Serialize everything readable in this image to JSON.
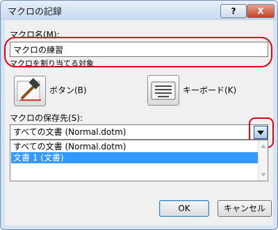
{
  "window": {
    "title": "マクロの記録",
    "help_glyph": "?",
    "close_glyph": "X"
  },
  "macro_name": {
    "label": "マクロ名(M):",
    "value": "マクロの練習"
  },
  "assign": {
    "label": "マクロを割り当てる対象",
    "button_label": "ボタン(B)",
    "keyboard_label": "キーボード(K)"
  },
  "store": {
    "label": "マクロの保存先(S):",
    "selected": "すべての文書 (Normal.dotm)",
    "options": [
      "すべての文書 (Normal.dotm)",
      "文書 1 (文書)"
    ]
  },
  "actions": {
    "ok": "OK",
    "cancel": "キャンセル"
  },
  "colors": {
    "highlight": "#e3001b",
    "selection": "#3399ff"
  }
}
